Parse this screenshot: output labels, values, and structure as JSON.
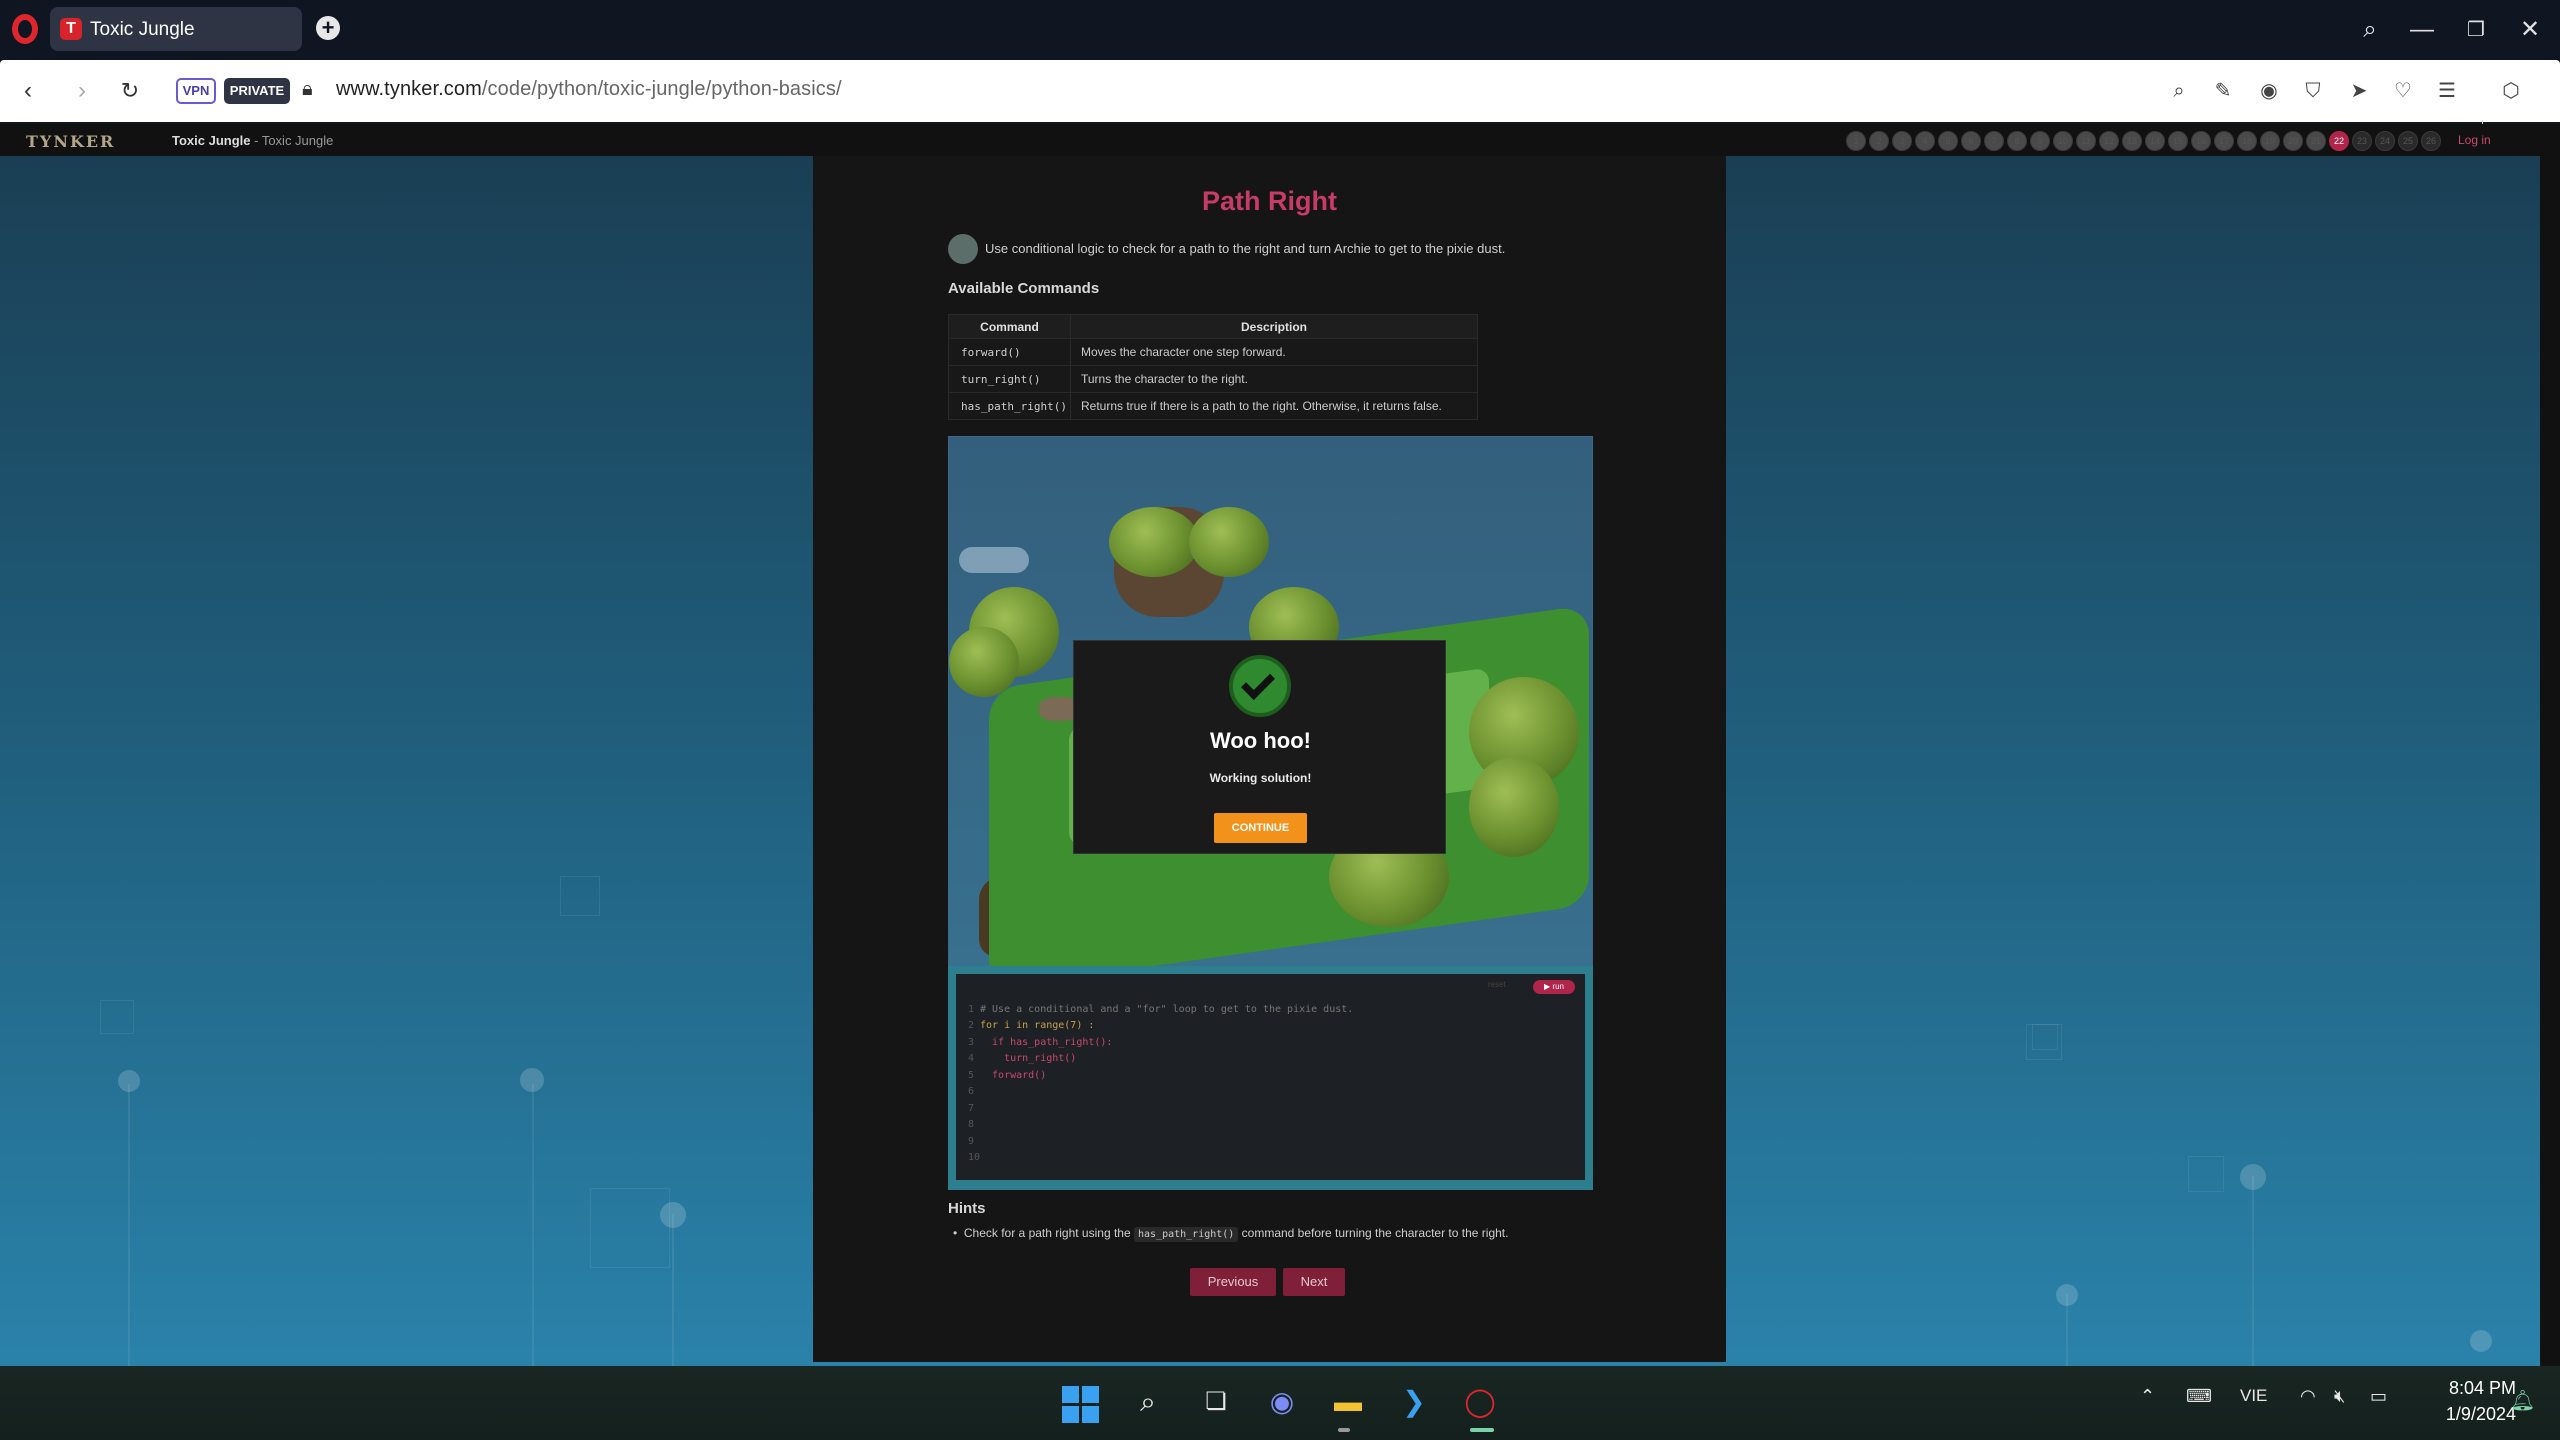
{
  "browser": {
    "tab_title": "Toxic Jungle",
    "tab_favicon": "T",
    "new_tab_icon": "plus-icon",
    "vpn_label": "VPN",
    "private_label": "PRIVATE",
    "url_domain": "www.tynker.com",
    "url_path": "/code/python/toxic-jungle/python-basics/"
  },
  "site": {
    "logo": "TYNKER",
    "breadcrumb_course": "Toxic Jungle",
    "breadcrumb_sep": " - ",
    "breadcrumb_level": "Toxic Jungle",
    "login_label": "Log in",
    "levels": [
      "1",
      "2",
      "3",
      "4",
      "5",
      "6",
      "7",
      "8",
      "9",
      "10",
      "11",
      "12",
      "13",
      "14",
      "15",
      "16",
      "17",
      "18",
      "19",
      "20",
      "21",
      "22",
      "23",
      "24",
      "25",
      "26"
    ],
    "current_level": "22"
  },
  "lesson": {
    "title": "Path Right",
    "intro": "Use conditional logic to check for a path to the right and turn Archie to get to the pixie dust.",
    "commands_heading": "Available Commands",
    "table_headers": [
      "Command",
      "Description"
    ],
    "commands": [
      {
        "code": "forward()",
        "desc": "Moves the character one step forward."
      },
      {
        "code": "turn_right()",
        "desc": "Turns the character to the right."
      },
      {
        "code": "has_path_right()",
        "desc": "Returns true if there is a path to the right. Otherwise, it returns false."
      }
    ],
    "hints_heading": "Hints",
    "hint_before": "Check for a path right using the ",
    "hint_code": "has_path_right()",
    "hint_after": " command before turning the character to the right.",
    "prev_label": "Previous",
    "next_label": "Next"
  },
  "editor": {
    "run_label": "▶ run",
    "reset_label": "reset",
    "lines": [
      {
        "n": "1",
        "text": "# Use a conditional and a \"for\" loop to get to the pixie dust."
      },
      {
        "n": "2",
        "text": "for i in range(7) :"
      },
      {
        "n": "3",
        "text": "  if has_path_right():"
      },
      {
        "n": "4",
        "text": "    turn_right()"
      },
      {
        "n": "5",
        "text": "  forward()"
      },
      {
        "n": "6",
        "text": ""
      },
      {
        "n": "7",
        "text": ""
      },
      {
        "n": "8",
        "text": ""
      },
      {
        "n": "9",
        "text": ""
      },
      {
        "n": "10",
        "text": ""
      }
    ]
  },
  "modal": {
    "title": "Woo hoo!",
    "subtitle": "Working solution!",
    "button": "CONTINUE"
  },
  "taskbar": {
    "language": "VIE",
    "time": "8:04 PM",
    "date": "1/9/2024"
  },
  "colors": {
    "accent": "#c63b67",
    "modal_button": "#f2921a",
    "success": "#2f8a2f"
  }
}
